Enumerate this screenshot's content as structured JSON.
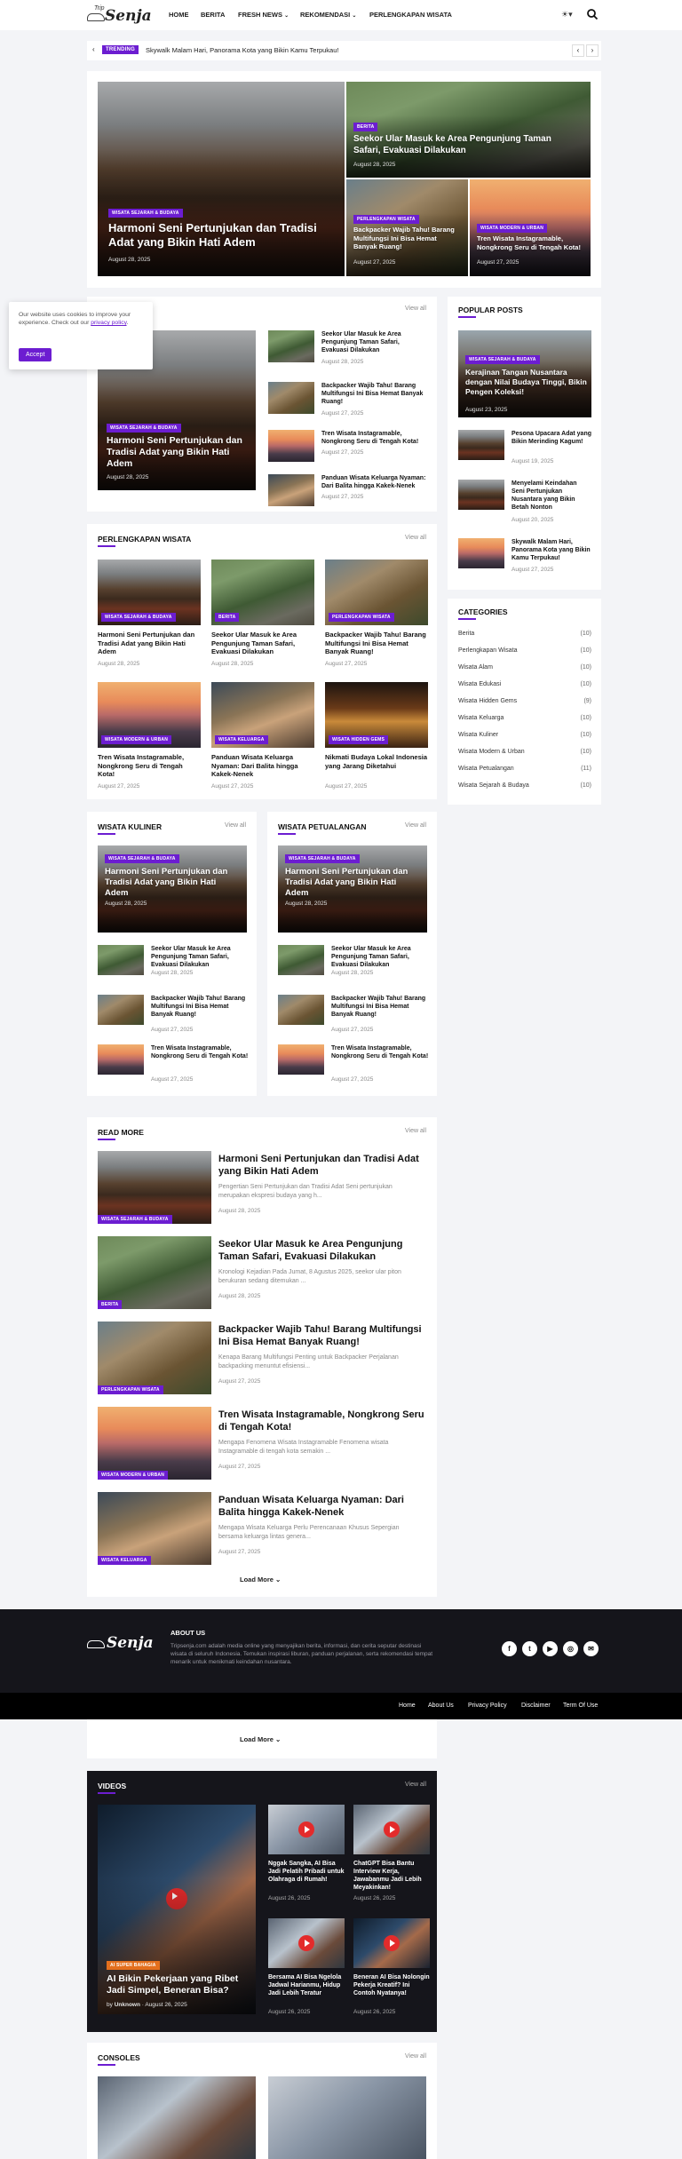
{
  "header": {
    "logo_small": "Trip",
    "logo": "Senja",
    "nav": [
      {
        "label": "HOME"
      },
      {
        "label": "BERITA"
      },
      {
        "label": "FRESH NEWS",
        "dropdown": true
      },
      {
        "label": "REKOMENDASI",
        "dropdown": true
      },
      {
        "label": "PERLENGKAPAN WISATA"
      }
    ]
  },
  "trending": {
    "label": "TRENDING",
    "text": "Skywalk Malam Hari, Panorama Kota yang Bikin Kamu Terpukau!"
  },
  "cookie": {
    "text": "Our website uses cookies to improve your experience. Check out our",
    "link": "privacy policy",
    "dot": ".",
    "button": "Accept"
  },
  "hero": {
    "main": {
      "tag": "WISATA SEJARAH & BUDAYA",
      "title": "Harmoni Seni Pertunjukan dan Tradisi Adat yang Bikin Hati Adem",
      "date": "August 28, 2025"
    },
    "top": {
      "tag": "BERITA",
      "title": "Seekor Ular Masuk ke Area Pengunjung Taman Safari, Evakuasi Dilakukan",
      "date": "August 28, 2025"
    },
    "bl": {
      "tag": "PERLENGKAPAN WISATA",
      "title": "Backpacker Wajib Tahu! Barang Multifungsi Ini Bisa Hemat Banyak Ruang!",
      "date": "August 27, 2025"
    },
    "br": {
      "tag": "WISATA MODERN & URBAN",
      "title": "Tren Wisata Instagramable, Nongkrong Seru di Tengah Kota!",
      "date": "August 27, 2025"
    }
  },
  "section1": {
    "view_all": "View all",
    "big": {
      "tag": "WISATA SEJARAH & BUDAYA",
      "title": "Harmoni Seni Pertunjukan dan Tradisi Adat yang Bikin Hati Adem",
      "date": "August 28, 2025"
    },
    "items": [
      {
        "title": "Seekor Ular Masuk ke Area Pengunjung Taman Safari, Evakuasi Dilakukan",
        "date": "August 28, 2025"
      },
      {
        "title": "Backpacker Wajib Tahu! Barang Multifungsi Ini Bisa Hemat Banyak Ruang!",
        "date": "August 27, 2025"
      },
      {
        "title": "Tren Wisata Instagramable, Nongkrong Seru di Tengah Kota!",
        "date": "August 27, 2025"
      },
      {
        "title": "Panduan Wisata Keluarga Nyaman: Dari Balita hingga Kakek-Nenek",
        "date": "August 27, 2025"
      }
    ]
  },
  "perlengkapan": {
    "title": "PERLENGKAPAN WISATA",
    "view_all": "View all",
    "items": [
      {
        "tag": "WISATA SEJARAH & BUDAYA",
        "title": "Harmoni Seni Pertunjukan dan Tradisi Adat yang Bikin Hati Adem",
        "date": "August 28, 2025"
      },
      {
        "tag": "BERITA",
        "title": "Seekor Ular Masuk ke Area Pengunjung Taman Safari, Evakuasi Dilakukan",
        "date": "August 28, 2025"
      },
      {
        "tag": "PERLENGKAPAN WISATA",
        "title": "Backpacker Wajib Tahu! Barang Multifungsi Ini Bisa Hemat Banyak Ruang!",
        "date": "August 27, 2025"
      },
      {
        "tag": "WISATA MODERN & URBAN",
        "title": "Tren Wisata Instagramable, Nongkrong Seru di Tengah Kota!",
        "date": "August 27, 2025"
      },
      {
        "tag": "WISATA KELUARGA",
        "title": "Panduan Wisata Keluarga Nyaman: Dari Balita hingga Kakek-Nenek",
        "date": "August 27, 2025"
      },
      {
        "tag": "WISATA HIDDEN GEMS",
        "title": "Nikmati Budaya Lokal Indonesia yang Jarang Diketahui",
        "date": "August 27, 2025"
      }
    ]
  },
  "kuliner": {
    "title": "WISATA KULINER",
    "view_all": "View all",
    "big": {
      "tag": "WISATA SEJARAH & BUDAYA",
      "title": "Harmoni Seni Pertunjukan dan Tradisi Adat yang Bikin Hati Adem",
      "date": "August 28, 2025"
    },
    "items": [
      {
        "title": "Seekor Ular Masuk ke Area Pengunjung Taman Safari, Evakuasi Dilakukan",
        "date": "August 28, 2025"
      },
      {
        "title": "Backpacker Wajib Tahu! Barang Multifungsi Ini Bisa Hemat Banyak Ruang!",
        "date": "August 27, 2025"
      },
      {
        "title": "Tren Wisata Instagramable, Nongkrong Seru di Tengah Kota!",
        "date": "August 27, 2025"
      }
    ]
  },
  "petualangan": {
    "title": "WISATA PETUALANGAN",
    "view_all": "View all",
    "big": {
      "tag": "WISATA SEJARAH & BUDAYA",
      "title": "Harmoni Seni Pertunjukan dan Tradisi Adat yang Bikin Hati Adem",
      "date": "August 28, 2025"
    },
    "items": [
      {
        "title": "Seekor Ular Masuk ke Area Pengunjung Taman Safari, Evakuasi Dilakukan",
        "date": "August 28, 2025"
      },
      {
        "title": "Backpacker Wajib Tahu! Barang Multifungsi Ini Bisa Hemat Banyak Ruang!",
        "date": "August 27, 2025"
      },
      {
        "title": "Tren Wisata Instagramable, Nongkrong Seru di Tengah Kota!",
        "date": "August 27, 2025"
      }
    ]
  },
  "popular": {
    "title": "POPULAR POSTS",
    "big": {
      "tag": "WISATA SEJARAH & BUDAYA",
      "title": "Kerajinan Tangan Nusantara dengan Nilai Budaya Tinggi, Bikin Pengen Koleksi!",
      "date": "August 23, 2025"
    },
    "items": [
      {
        "title": "Pesona Upacara Adat yang Bikin Merinding Kagum!",
        "date": "August 19, 2025"
      },
      {
        "title": "Menyelami Keindahan Seni Pertunjukan Nusantara yang Bikin Betah Nonton",
        "date": "August 20, 2025"
      },
      {
        "title": "Skywalk Malam Hari, Panorama Kota yang Bikin Kamu Terpukau!",
        "date": "August 27, 2025"
      }
    ]
  },
  "categories": {
    "title": "CATEGORIES",
    "items": [
      {
        "name": "Berita",
        "count": "(10)"
      },
      {
        "name": "Perlengkapan Wisata",
        "count": "(10)"
      },
      {
        "name": "Wisata Alam",
        "count": "(10)"
      },
      {
        "name": "Wisata Edukasi",
        "count": "(10)"
      },
      {
        "name": "Wisata Hidden Gems",
        "count": "(9)"
      },
      {
        "name": "Wisata Keluarga",
        "count": "(10)"
      },
      {
        "name": "Wisata Kuliner",
        "count": "(10)"
      },
      {
        "name": "Wisata Modern & Urban",
        "count": "(10)"
      },
      {
        "name": "Wisata Petualangan",
        "count": "(11)"
      },
      {
        "name": "Wisata Sejarah & Budaya",
        "count": "(10)"
      }
    ]
  },
  "readmore": {
    "title": "READ MORE",
    "view_all": "View all",
    "load_more": "Load More",
    "items": [
      {
        "tag": "WISATA SEJARAH & BUDAYA",
        "title": "Harmoni Seni Pertunjukan dan Tradisi Adat yang Bikin Hati Adem",
        "excerpt": "Pengertian Seni Pertunjukan dan Tradisi Adat Seni pertunjukan merupakan ekspresi budaya yang h...",
        "date": "August 28, 2025"
      },
      {
        "tag": "BERITA",
        "title": "Seekor Ular Masuk ke Area Pengunjung Taman Safari, Evakuasi Dilakukan",
        "excerpt": "Kronologi Kejadian Pada Jumat, 8 Agustus 2025, seekor ular piton berukuran sedang ditemukan ...",
        "date": "August 28, 2025"
      },
      {
        "tag": "PERLENGKAPAN WISATA",
        "title": "Backpacker Wajib Tahu! Barang Multifungsi Ini Bisa Hemat Banyak Ruang!",
        "excerpt": "Kenapa Barang Multifungsi Penting untuk Backpacker Perjalanan backpacking menuntut efisiensi...",
        "date": "August 27, 2025"
      },
      {
        "tag": "WISATA MODERN & URBAN",
        "title": "Tren Wisata Instagramable, Nongkrong Seru di Tengah Kota!",
        "excerpt": "Mengapa Fenomena Wisata Instagramable Fenomena wisata Instagramable di tengah kota semakin ...",
        "date": "August 27, 2025"
      },
      {
        "tag": "WISATA KELUARGA",
        "title": "Panduan Wisata Keluarga Nyaman: Dari Balita hingga Kakek-Nenek",
        "excerpt": "Mengapa Wisata Keluarga Perlu Perencanaan Khusus Sepergian bersama keluarga lintas genera...",
        "date": "August 27, 2025"
      }
    ]
  },
  "footer": {
    "about_title": "ABOUT US",
    "about_text": "Tripsenja.com adalah media online yang menyajikan berita, informasi, dan cerita seputar destinasi wisata di seluruh Indonesia. Temukan inspirasi liburan, panduan perjalanan, serta rekomendasi tempat menarik untuk menikmati keindahan nusantara.",
    "links": [
      "Home",
      "About Us",
      "Privacy Policy",
      "Disclaimer",
      "Term Of Use"
    ],
    "social": [
      "f",
      "t",
      "▶",
      "◎",
      "✉"
    ]
  },
  "load_more2": "Load More",
  "videos": {
    "title": "VIDEOS",
    "view_all": "View all",
    "big": {
      "tag": "AI SUPER BAHAGIA",
      "title": "AI Bikin Pekerjaan yang Ribet Jadi Simpel, Beneran Bisa?",
      "by": "by",
      "author": "Unknown",
      "date": "August 26, 2025"
    },
    "items": [
      {
        "title": "Nggak Sangka, AI Bisa Jadi Pelatih Pribadi untuk Olahraga di Rumah!",
        "date": "August 26, 2025"
      },
      {
        "title": "ChatGPT Bisa Bantu Interview Kerja, Jawabanmu Jadi Lebih Meyakinkan!",
        "date": "August 26, 2025"
      },
      {
        "title": "Bersama AI Bisa Ngelola Jadwal Harianmu, Hidup Jadi Lebih Teratur",
        "date": "August 26, 2025"
      },
      {
        "title": "Beneran AI Bisa Nolongin Pekerja Kreatif? Ini Contoh Nyatanya!",
        "date": "August 26, 2025"
      }
    ]
  },
  "consoles": {
    "title": "CONSOLES",
    "view_all": "View all"
  },
  "colors": {
    "accent": "#6c1dd1",
    "footer_bg": "#15151b",
    "bar_bg": "#000000"
  }
}
